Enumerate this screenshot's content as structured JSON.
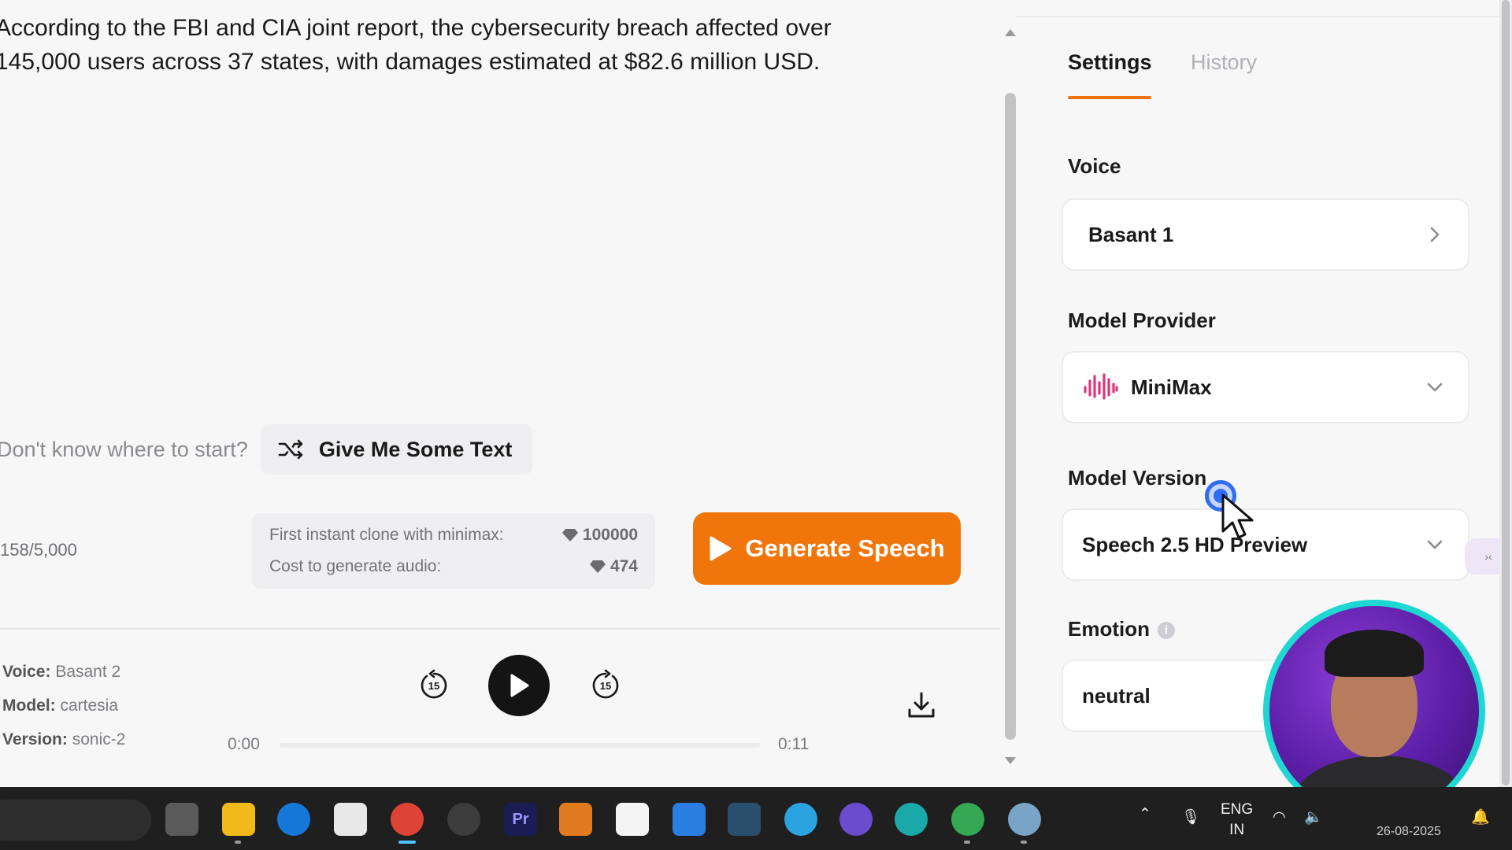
{
  "editor": {
    "line1": "According to the FBI and CIA joint report, the cybersecurity breach affected over",
    "line2": "145,000 users across 37 states, with damages estimated at $82.6 million USD."
  },
  "hint": {
    "label": "Don't know where to start?",
    "button": "Give Me Some Text"
  },
  "char_count": "158/5,000",
  "cost": {
    "clone_label": "First instant clone with minimax:",
    "clone_value": "100000",
    "audio_label": "Cost to generate audio:",
    "audio_value": "474"
  },
  "generate_button": "Generate Speech",
  "player": {
    "voice_label": "Voice:",
    "voice_value": "Basant 2",
    "model_label": "Model:",
    "model_value": "cartesia",
    "version_label": "Version:",
    "version_value": "sonic-2",
    "current_time": "0:00",
    "duration": "0:11",
    "skip_back": "15",
    "skip_forward": "15",
    "progress": 0
  },
  "tabs": {
    "settings": "Settings",
    "history": "History"
  },
  "settings": {
    "voice_label": "Voice",
    "voice_value": "Basant 1",
    "provider_label": "Model Provider",
    "provider_value": "MiniMax",
    "version_label": "Model Version",
    "version_value": "Speech 2.5 HD Preview",
    "emotion_label": "Emotion",
    "emotion_value": "neutral"
  },
  "taskbar": {
    "lang_top": "ENG",
    "lang_bottom": "IN",
    "date": "26-08-2025"
  },
  "colors": {
    "accent": "#f0760c",
    "brand_minimax": "#e0357a",
    "webcam_ring": "#1ed6d2"
  }
}
